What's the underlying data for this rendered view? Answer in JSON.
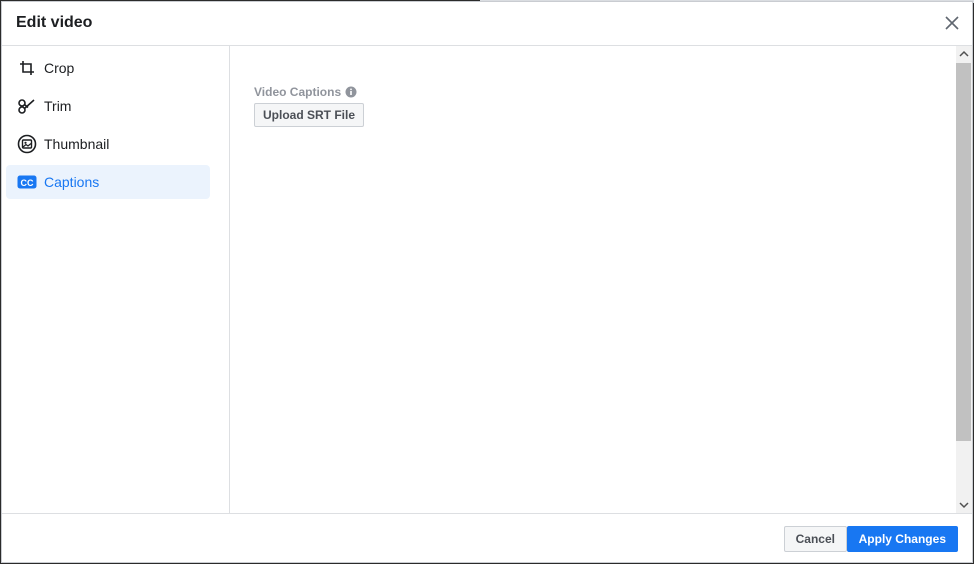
{
  "dialog": {
    "title": "Edit video"
  },
  "sidebar": {
    "items": [
      {
        "label": "Crop",
        "icon": "crop-icon",
        "active": false
      },
      {
        "label": "Trim",
        "icon": "scissors-icon",
        "active": false
      },
      {
        "label": "Thumbnail",
        "icon": "thumbnail-icon",
        "active": false
      },
      {
        "label": "Captions",
        "icon": "cc-icon",
        "active": true
      }
    ]
  },
  "main": {
    "section_label": "Video Captions",
    "upload_button": "Upload SRT File"
  },
  "footer": {
    "cancel_label": "Cancel",
    "apply_label": "Apply Changes"
  },
  "colors": {
    "accent": "#1877f2",
    "active_bg": "#ebf3fd"
  }
}
